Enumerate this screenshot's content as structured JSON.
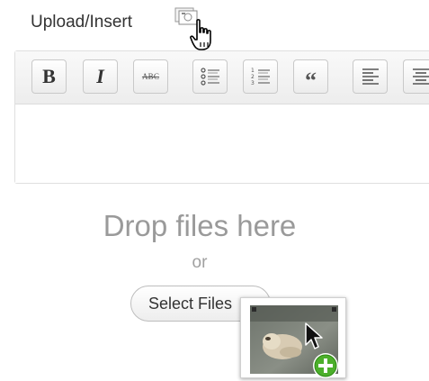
{
  "upload": {
    "label": "Upload/Insert",
    "media_icon": "add-media-icon",
    "cursor_icon": "hand-pointer-icon"
  },
  "toolbar": {
    "buttons": [
      {
        "name": "bold-button",
        "label": "B"
      },
      {
        "name": "italic-button",
        "label": "I"
      },
      {
        "name": "strikethrough-button",
        "label": "ABC"
      },
      {
        "name": "bullet-list-button",
        "icon": "bullet-list-icon"
      },
      {
        "name": "numbered-list-button",
        "icon": "numbered-list-icon"
      },
      {
        "name": "blockquote-button",
        "label": "“"
      },
      {
        "name": "align-left-button",
        "icon": "align-left-icon"
      },
      {
        "name": "align-center-button",
        "icon": "align-center-icon"
      }
    ]
  },
  "dropzone": {
    "title": "Drop files here",
    "or_text": "or",
    "select_button": "Select Files"
  },
  "drag": {
    "thumbnail_icon": "photo-thumbnail-icon",
    "cursor_icon": "arrow-cursor-icon",
    "badge_icon": "add-plus-icon"
  },
  "colors": {
    "badge_green": "#4caf2b",
    "drop_text": "#9a9a9a"
  }
}
